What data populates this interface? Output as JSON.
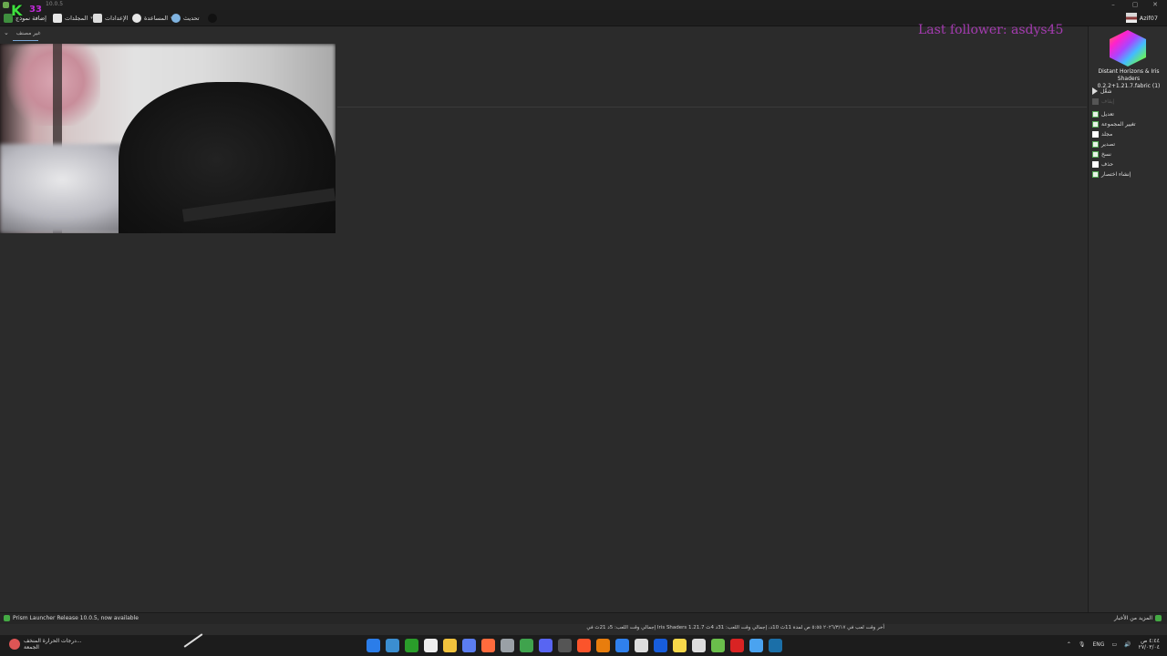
{
  "window": {
    "title": "10.0.5",
    "controls": [
      "–",
      "▢",
      "✕"
    ]
  },
  "overlay": {
    "logo_k": "K",
    "logo_s": "33",
    "follower": "Last follower: asdys45"
  },
  "toolbar": {
    "add_instance": "إضافة نموذج",
    "folders": "المجلدات",
    "settings": "الإعدادات",
    "help": "المساعدة",
    "update": "تحديث",
    "username": "Azif07"
  },
  "group": {
    "label": "غير مصنف"
  },
  "instance": {
    "name": "Distant Horizons & Iris Shaders 0.2.2+1.21.7.fabric (1)",
    "actions": [
      {
        "label": "شغّل",
        "kind": "play",
        "enabled": true
      },
      {
        "label": "إيقاف",
        "kind": "stop",
        "enabled": false
      },
      {
        "label": "تعديل",
        "kind": "edit",
        "enabled": true
      },
      {
        "label": "تغيير المجموعة",
        "kind": "group",
        "enabled": true
      },
      {
        "label": "مجلد",
        "kind": "folder",
        "enabled": true
      },
      {
        "label": "تصدير",
        "kind": "export",
        "enabled": true
      },
      {
        "label": "نسخ",
        "kind": "copy",
        "enabled": true
      },
      {
        "label": "حذف",
        "kind": "delete",
        "enabled": true
      },
      {
        "label": "إنشاء اختصار",
        "kind": "shortcut",
        "enabled": true
      }
    ]
  },
  "status": {
    "update_notice": "Prism Launcher Release 10.0.5, now available",
    "more_news": "المزيد من الأخبار",
    "playtime": "إجمالي وقت اللعب: 5د 21ث في Iris Shaders 1.21.7 أخر وقت لعب في ٢٠٢٦/٣/١٧ ٥:٥٥ ص لمدة 11ث 10د، إجمالي وقت اللعب: 31د 4ث"
  },
  "taskbar": {
    "weather_line1": "درجات الحرارة المنخف...",
    "weather_line2": "الجمعة",
    "lang": "ENG",
    "time": "٤:٤٤ ص",
    "date": "٢٧/٠٣/٠٤",
    "apps": [
      {
        "icon": "windows-start-icon",
        "color": "#2b7de9"
      },
      {
        "icon": "task-view-icon",
        "color": "#3b8ed0"
      },
      {
        "icon": "xbox-icon",
        "color": "#2a9d2a"
      },
      {
        "icon": "capcut-icon",
        "color": "#eeeeee"
      },
      {
        "icon": "file-explorer-icon",
        "color": "#f2c33d"
      },
      {
        "icon": "copilot-icon",
        "color": "#5b7df0"
      },
      {
        "icon": "firefox-icon",
        "color": "#ff6b3d"
      },
      {
        "icon": "app-cube-icon",
        "color": "#9aa0a6"
      },
      {
        "icon": "minecraft-icon",
        "color": "#3fa34d"
      },
      {
        "icon": "discord-icon",
        "color": "#5865f2"
      },
      {
        "icon": "obs-icon",
        "color": "#555555"
      },
      {
        "icon": "brave-icon",
        "color": "#fb542b"
      },
      {
        "icon": "blender-icon",
        "color": "#e87d0d"
      },
      {
        "icon": "vscode-icon",
        "color": "#2f80ed"
      },
      {
        "icon": "notepad-icon",
        "color": "#dddddd"
      },
      {
        "icon": "bitwarden-icon",
        "color": "#175ddc"
      },
      {
        "icon": "sticky-notes-icon",
        "color": "#f7d84a"
      },
      {
        "icon": "onedrive-icon",
        "color": "#dddddd"
      },
      {
        "icon": "prism-launcher-icon",
        "color": "#6abf4b"
      },
      {
        "icon": "acrobat-icon",
        "color": "#d92323"
      },
      {
        "icon": "store-icon",
        "color": "#4aa3f0"
      },
      {
        "icon": "steam-icon",
        "color": "#1b6fa8"
      }
    ]
  }
}
